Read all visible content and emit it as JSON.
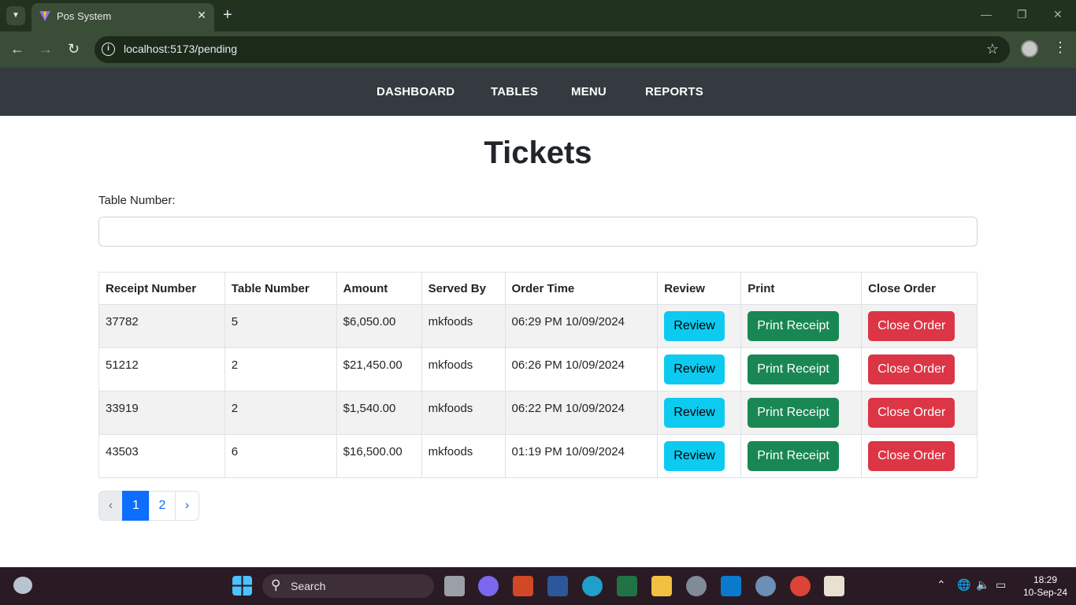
{
  "browser": {
    "tab_title": "Pos System",
    "url": "localhost:5173/pending"
  },
  "nav": {
    "items": [
      {
        "label": "DASHBOARD"
      },
      {
        "label": "TABLES"
      },
      {
        "label": "MENU"
      },
      {
        "label": "REPORTS"
      }
    ]
  },
  "page": {
    "title": "Tickets",
    "filter_label": "Table Number:",
    "filter_value": ""
  },
  "table": {
    "headers": [
      "Receipt Number",
      "Table Number",
      "Amount",
      "Served By",
      "Order Time",
      "Review",
      "Print",
      "Close Order"
    ],
    "rows": [
      {
        "receipt": "37782",
        "table": "5",
        "amount": "$6,050.00",
        "served_by": "mkfoods",
        "time": "06:29 PM 10/09/2024"
      },
      {
        "receipt": "51212",
        "table": "2",
        "amount": "$21,450.00",
        "served_by": "mkfoods",
        "time": "06:26 PM 10/09/2024"
      },
      {
        "receipt": "33919",
        "table": "2",
        "amount": "$1,540.00",
        "served_by": "mkfoods",
        "time": "06:22 PM 10/09/2024"
      },
      {
        "receipt": "43503",
        "table": "6",
        "amount": "$16,500.00",
        "served_by": "mkfoods",
        "time": "01:19 PM 10/09/2024"
      }
    ],
    "buttons": {
      "review": "Review",
      "print": "Print Receipt",
      "close": "Close Order"
    }
  },
  "pagination": {
    "prev": "‹",
    "pages": [
      "1",
      "2"
    ],
    "current": "1",
    "next": "›"
  },
  "taskbar": {
    "search_label": "Search",
    "time": "18:29",
    "date": "10-Sep-24"
  },
  "colors": {
    "navbar_bg": "#343a40",
    "review_btn": "#0dcaf0",
    "print_btn": "#198754",
    "close_btn": "#dc3545",
    "page_active": "#0d6efd"
  }
}
